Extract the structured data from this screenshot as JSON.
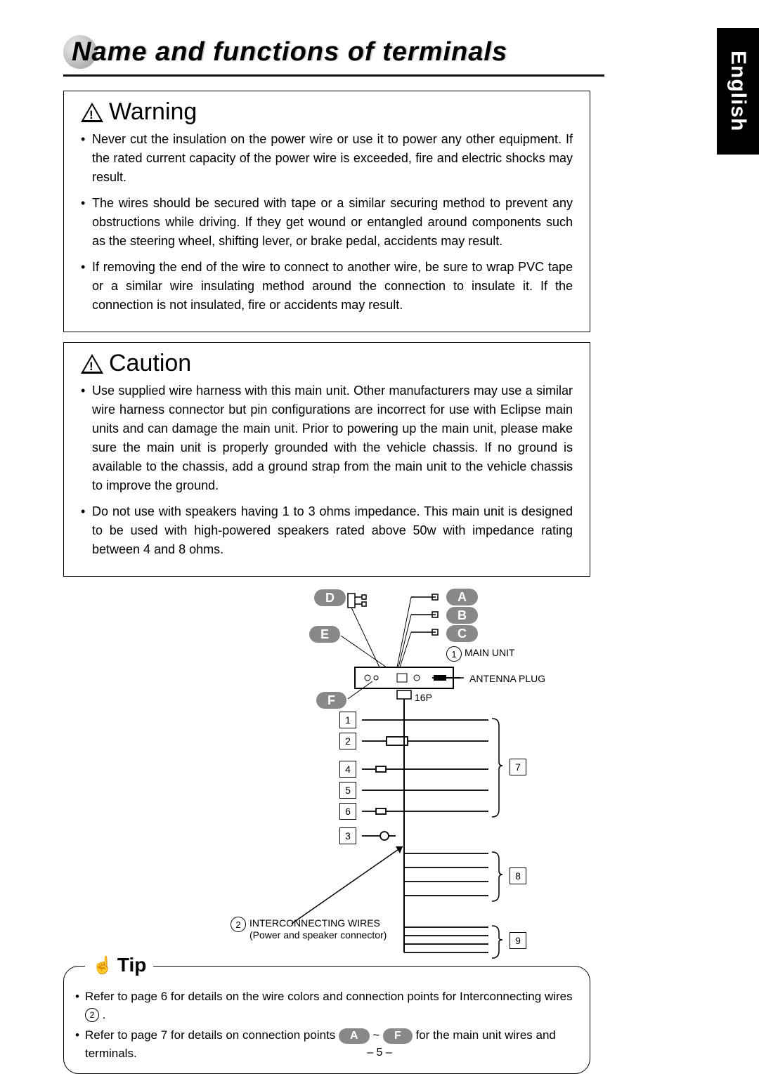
{
  "lang_tab": "English",
  "title": "Name and functions of terminals",
  "warning": {
    "heading": "Warning",
    "items": [
      "Never cut the insulation on the power wire or use it to power any other equipment. If the rated current capacity of the power wire is exceeded, fire and electric shocks may result.",
      "The wires should be secured with tape or a similar securing method to prevent any obstructions while driving. If they get wound or entangled around components such as the steering wheel, shifting lever, or brake pedal, accidents may result.",
      "If removing the end of the wire to connect to another wire, be sure to wrap PVC tape or a similar wire insulating method around the connection to insulate it. If the connection is not insulated, fire or accidents may result."
    ]
  },
  "caution": {
    "heading": "Caution",
    "items": [
      "Use supplied wire harness with this main unit.  Other manufacturers may use a similar wire harness connector but pin configurations are incorrect for use with Eclipse main units and can damage the main unit.  Prior to powering up the main unit, please make sure the main unit is properly grounded with the vehicle chassis.  If no ground is available to the chassis, add a ground strap from the main unit to the vehicle chassis to improve the ground.",
      "Do not use with speakers having 1 to 3 ohms impedance.  This main unit is designed to be used with high-powered speakers rated above 50w with impedance rating between 4 and 8 ohms."
    ]
  },
  "diagram": {
    "labels": {
      "A": "A",
      "B": "B",
      "C": "C",
      "D": "D",
      "E": "E",
      "F": "F"
    },
    "main_unit": "MAIN UNIT",
    "antenna": "ANTENNA PLUG",
    "sixteen_p": "16P",
    "interconnecting": "INTERCONNECTING WIRES",
    "interconnecting_sub": "(Power and speaker connector)",
    "circles": {
      "1": "1",
      "2": "2"
    },
    "boxes": {
      "1": "1",
      "2": "2",
      "3": "3",
      "4": "4",
      "5": "5",
      "6": "6",
      "7": "7",
      "8": "8",
      "9": "9"
    }
  },
  "tip": {
    "label": "Tip",
    "line1_pre": "Refer to page 6 for details on the wire colors and connection points for Interconnecting wires ",
    "line1_circ": "2",
    "line1_post": " .",
    "line2_pre": "Refer to page 7 for details on connection points ",
    "line2_a": "A",
    "line2_mid": " ~ ",
    "line2_f": "F",
    "line2_post": " for the main unit wires and terminals."
  },
  "page_num": "– 5 –"
}
